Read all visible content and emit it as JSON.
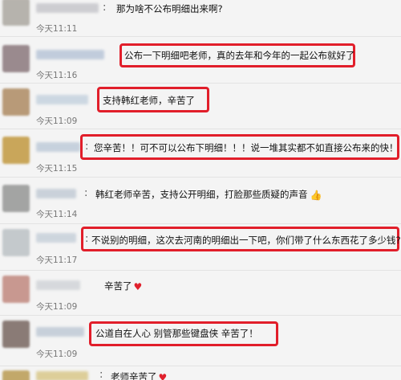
{
  "comments": [
    {
      "text": "那为啥不公布明细出来啊?",
      "time": "今天11:11",
      "avatar_color": "#b6b3ad",
      "name_color": "#c7c7cc",
      "highlighted": false,
      "emoji": ""
    },
    {
      "text": "公布一下明细吧老师，真的去年和今年的一起公布就好了",
      "time": "今天11:16",
      "avatar_color": "#9a8a8e",
      "name_color": "#b9c6d8",
      "highlighted": true,
      "emoji": ""
    },
    {
      "text": "支持韩红老师，辛苦了",
      "time": "今天11:09",
      "avatar_color": "#b89a78",
      "name_color": "#c6d3df",
      "highlighted": true,
      "emoji": ""
    },
    {
      "text": "您辛苦！！可不可以公布下明细！！！说一堆其实都不如直接公布来的快！",
      "time": "今天11:15",
      "avatar_color": "#c9a65a",
      "name_color": "#bfcbd9",
      "highlighted": true,
      "emoji": ""
    },
    {
      "text": "韩红老师辛苦，支持公开明细，打脸那些质疑的声音",
      "time": "今天11:14",
      "avatar_color": "#a3a4a3",
      "name_color": "#c3ccd6",
      "highlighted": false,
      "emoji": "thumbs-up"
    },
    {
      "text": "不说别的明细，这次去河南的明细出一下吧，你们带了什么东西花了多少钱?",
      "time": "今天11:17",
      "avatar_color": "#c4c9cc",
      "name_color": "#c7d0da",
      "highlighted": true,
      "emoji": ""
    },
    {
      "text": "辛苦了",
      "time": "今天11:09",
      "avatar_color": "#c89890",
      "name_color": "#d1d4d8",
      "highlighted": false,
      "emoji": "heart"
    },
    {
      "text": "公道自在人心 别管那些键盘侠 辛苦了！",
      "time": "今天11:09",
      "avatar_color": "#8a7b76",
      "name_color": "#c0cad6",
      "highlighted": true,
      "emoji": ""
    },
    {
      "text": "老师辛苦了",
      "time": "",
      "avatar_color": "#c2a86a",
      "name_color": "#d9c88a",
      "highlighted": false,
      "emoji": "heart"
    }
  ],
  "icons": {
    "heart": "♥",
    "thumbs-up": "👍"
  },
  "colors": {
    "highlight_border": "#e11e2a",
    "background": "#f4f4f4",
    "time_text": "#777777"
  }
}
